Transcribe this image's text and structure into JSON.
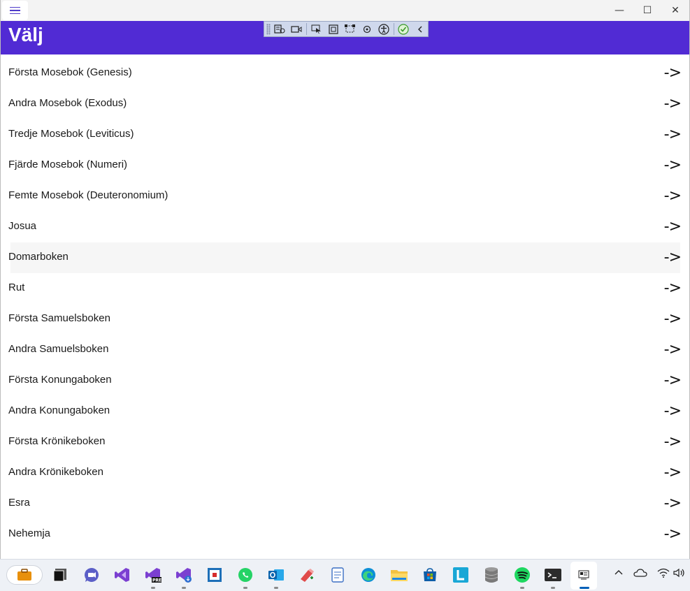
{
  "app": {
    "title": "Välj",
    "menu_icon": "hamburger-icon",
    "accent_color": "#512bd4"
  },
  "window_controls": {
    "minimize": "—",
    "maximize": "☐",
    "close": "✕"
  },
  "dev_toolbar": {
    "tools": [
      "live-visual-tree-icon",
      "record-icon",
      "select-element-icon",
      "display-layout-adorners-icon",
      "track-focus-icon",
      "hot-reload-icon",
      "accessibility-icon",
      "binding-ok-icon",
      "collapse-chevron-icon"
    ]
  },
  "books": [
    {
      "label": "Första Mosebok (Genesis)",
      "arrow": "->"
    },
    {
      "label": "Andra Mosebok (Exodus)",
      "arrow": "->"
    },
    {
      "label": "Tredje Mosebok (Leviticus)",
      "arrow": "->"
    },
    {
      "label": "Fjärde Mosebok (Numeri)",
      "arrow": "->"
    },
    {
      "label": "Femte Mosebok (Deuteronomium)",
      "arrow": "->"
    },
    {
      "label": "Josua",
      "arrow": "->"
    },
    {
      "label": "Domarboken",
      "arrow": "->"
    },
    {
      "label": "Rut",
      "arrow": "->"
    },
    {
      "label": "Första Samuelsboken",
      "arrow": "->"
    },
    {
      "label": "Andra Samuelsboken",
      "arrow": "->"
    },
    {
      "label": "Första Konungaboken",
      "arrow": "->"
    },
    {
      "label": "Andra Konungaboken",
      "arrow": "->"
    },
    {
      "label": "Första Krönikeboken",
      "arrow": "->"
    },
    {
      "label": "Andra Krönikeboken",
      "arrow": "->"
    },
    {
      "label": "Esra",
      "arrow": "->"
    },
    {
      "label": "Nehemja",
      "arrow": "->"
    }
  ],
  "taskbar": {
    "apps": [
      "briefcase-icon",
      "terminal-dark-icon",
      "teams-chat-icon",
      "visual-studio-icon",
      "visual-studio-preview-icon",
      "visual-studio-installer-icon",
      "snipping-tool-icon",
      "whatsapp-icon",
      "outlook-icon",
      "paint-icon",
      "notepad-icon",
      "edge-icon",
      "file-explorer-icon",
      "microsoft-store-icon",
      "l-app-icon",
      "database-icon",
      "spotify-icon",
      "windows-terminal-icon",
      "active-app-icon"
    ],
    "tray": [
      "chevron-up-icon",
      "onedrive-cloud-icon",
      "wifi-icon",
      "speaker-icon"
    ]
  }
}
